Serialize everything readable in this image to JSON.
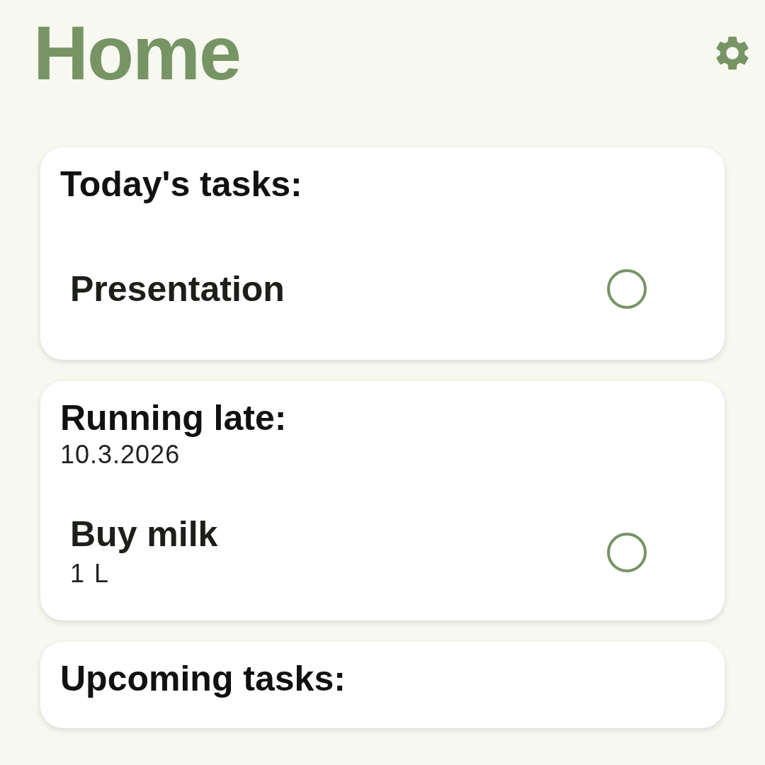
{
  "title": "Home",
  "sections": [
    {
      "title": "Today's tasks:",
      "tasks": [
        {
          "name": "Presentation",
          "checked": false
        }
      ]
    },
    {
      "title": "Running late:",
      "date": "10.3.2026",
      "tasks": [
        {
          "name": "Buy milk",
          "note": "1 L",
          "checked": false
        }
      ]
    },
    {
      "title": "Upcoming tasks:"
    }
  ]
}
